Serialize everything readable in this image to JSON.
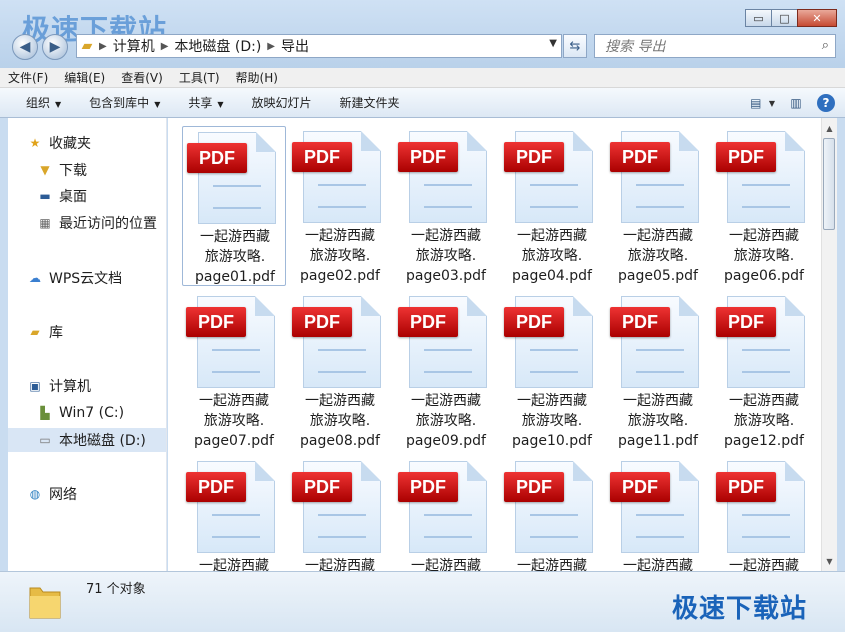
{
  "window": {
    "watermark": "极速下载站"
  },
  "window_controls": {
    "minimize": "▭",
    "maximize": "□",
    "close": "✕"
  },
  "address": {
    "segments": [
      "计算机",
      "本地磁盘 (D:)",
      "导出"
    ]
  },
  "search": {
    "placeholder": "搜索 导出"
  },
  "menu": {
    "items": [
      "文件(F)",
      "编辑(E)",
      "查看(V)",
      "工具(T)",
      "帮助(H)"
    ]
  },
  "toolbar": {
    "items": [
      {
        "label": "组织",
        "dropdown": true
      },
      {
        "label": "包含到库中",
        "dropdown": true
      },
      {
        "label": "共享",
        "dropdown": true
      },
      {
        "label": "放映幻灯片",
        "dropdown": false
      },
      {
        "label": "新建文件夹",
        "dropdown": false
      }
    ]
  },
  "sidebar": {
    "items": [
      {
        "label": "收藏夹",
        "icon": "star-icon"
      },
      {
        "label": "下载",
        "icon": "download-folder-icon"
      },
      {
        "label": "桌面",
        "icon": "desktop-icon"
      },
      {
        "label": "最近访问的位置",
        "icon": "recent-places-icon"
      },
      {
        "label": "WPS云文档",
        "icon": "cloud-icon"
      },
      {
        "label": "库",
        "icon": "library-icon"
      },
      {
        "label": "计算机",
        "icon": "computer-icon"
      },
      {
        "label": "Win7 (C:)",
        "icon": "system-drive-icon"
      },
      {
        "label": "本地磁盘 (D:)",
        "icon": "drive-icon"
      },
      {
        "label": "网络",
        "icon": "network-icon"
      }
    ]
  },
  "files": {
    "badge": "PDF",
    "items": [
      {
        "line1": "一起游西藏",
        "line2": "旅游攻略.",
        "line3": "page01.pdf"
      },
      {
        "line1": "一起游西藏",
        "line2": "旅游攻略.",
        "line3": "page02.pdf"
      },
      {
        "line1": "一起游西藏",
        "line2": "旅游攻略.",
        "line3": "page03.pdf"
      },
      {
        "line1": "一起游西藏",
        "line2": "旅游攻略.",
        "line3": "page04.pdf"
      },
      {
        "line1": "一起游西藏",
        "line2": "旅游攻略.",
        "line3": "page05.pdf"
      },
      {
        "line1": "一起游西藏",
        "line2": "旅游攻略.",
        "line3": "page06.pdf"
      },
      {
        "line1": "一起游西藏",
        "line2": "旅游攻略.",
        "line3": "page07.pdf"
      },
      {
        "line1": "一起游西藏",
        "line2": "旅游攻略.",
        "line3": "page08.pdf"
      },
      {
        "line1": "一起游西藏",
        "line2": "旅游攻略.",
        "line3": "page09.pdf"
      },
      {
        "line1": "一起游西藏",
        "line2": "旅游攻略.",
        "line3": "page10.pdf"
      },
      {
        "line1": "一起游西藏",
        "line2": "旅游攻略.",
        "line3": "page11.pdf"
      },
      {
        "line1": "一起游西藏",
        "line2": "旅游攻略.",
        "line3": "page12.pdf"
      },
      {
        "line1": "一起游西藏",
        "line2": "",
        "line3": ""
      },
      {
        "line1": "一起游西藏",
        "line2": "",
        "line3": ""
      },
      {
        "line1": "一起游西藏",
        "line2": "",
        "line3": ""
      },
      {
        "line1": "一起游西藏",
        "line2": "",
        "line3": ""
      },
      {
        "line1": "一起游西藏",
        "line2": "",
        "line3": ""
      },
      {
        "line1": "一起游西藏",
        "line2": "",
        "line3": ""
      }
    ]
  },
  "status": {
    "count": "71 个对象",
    "brand": "极速下载站"
  }
}
